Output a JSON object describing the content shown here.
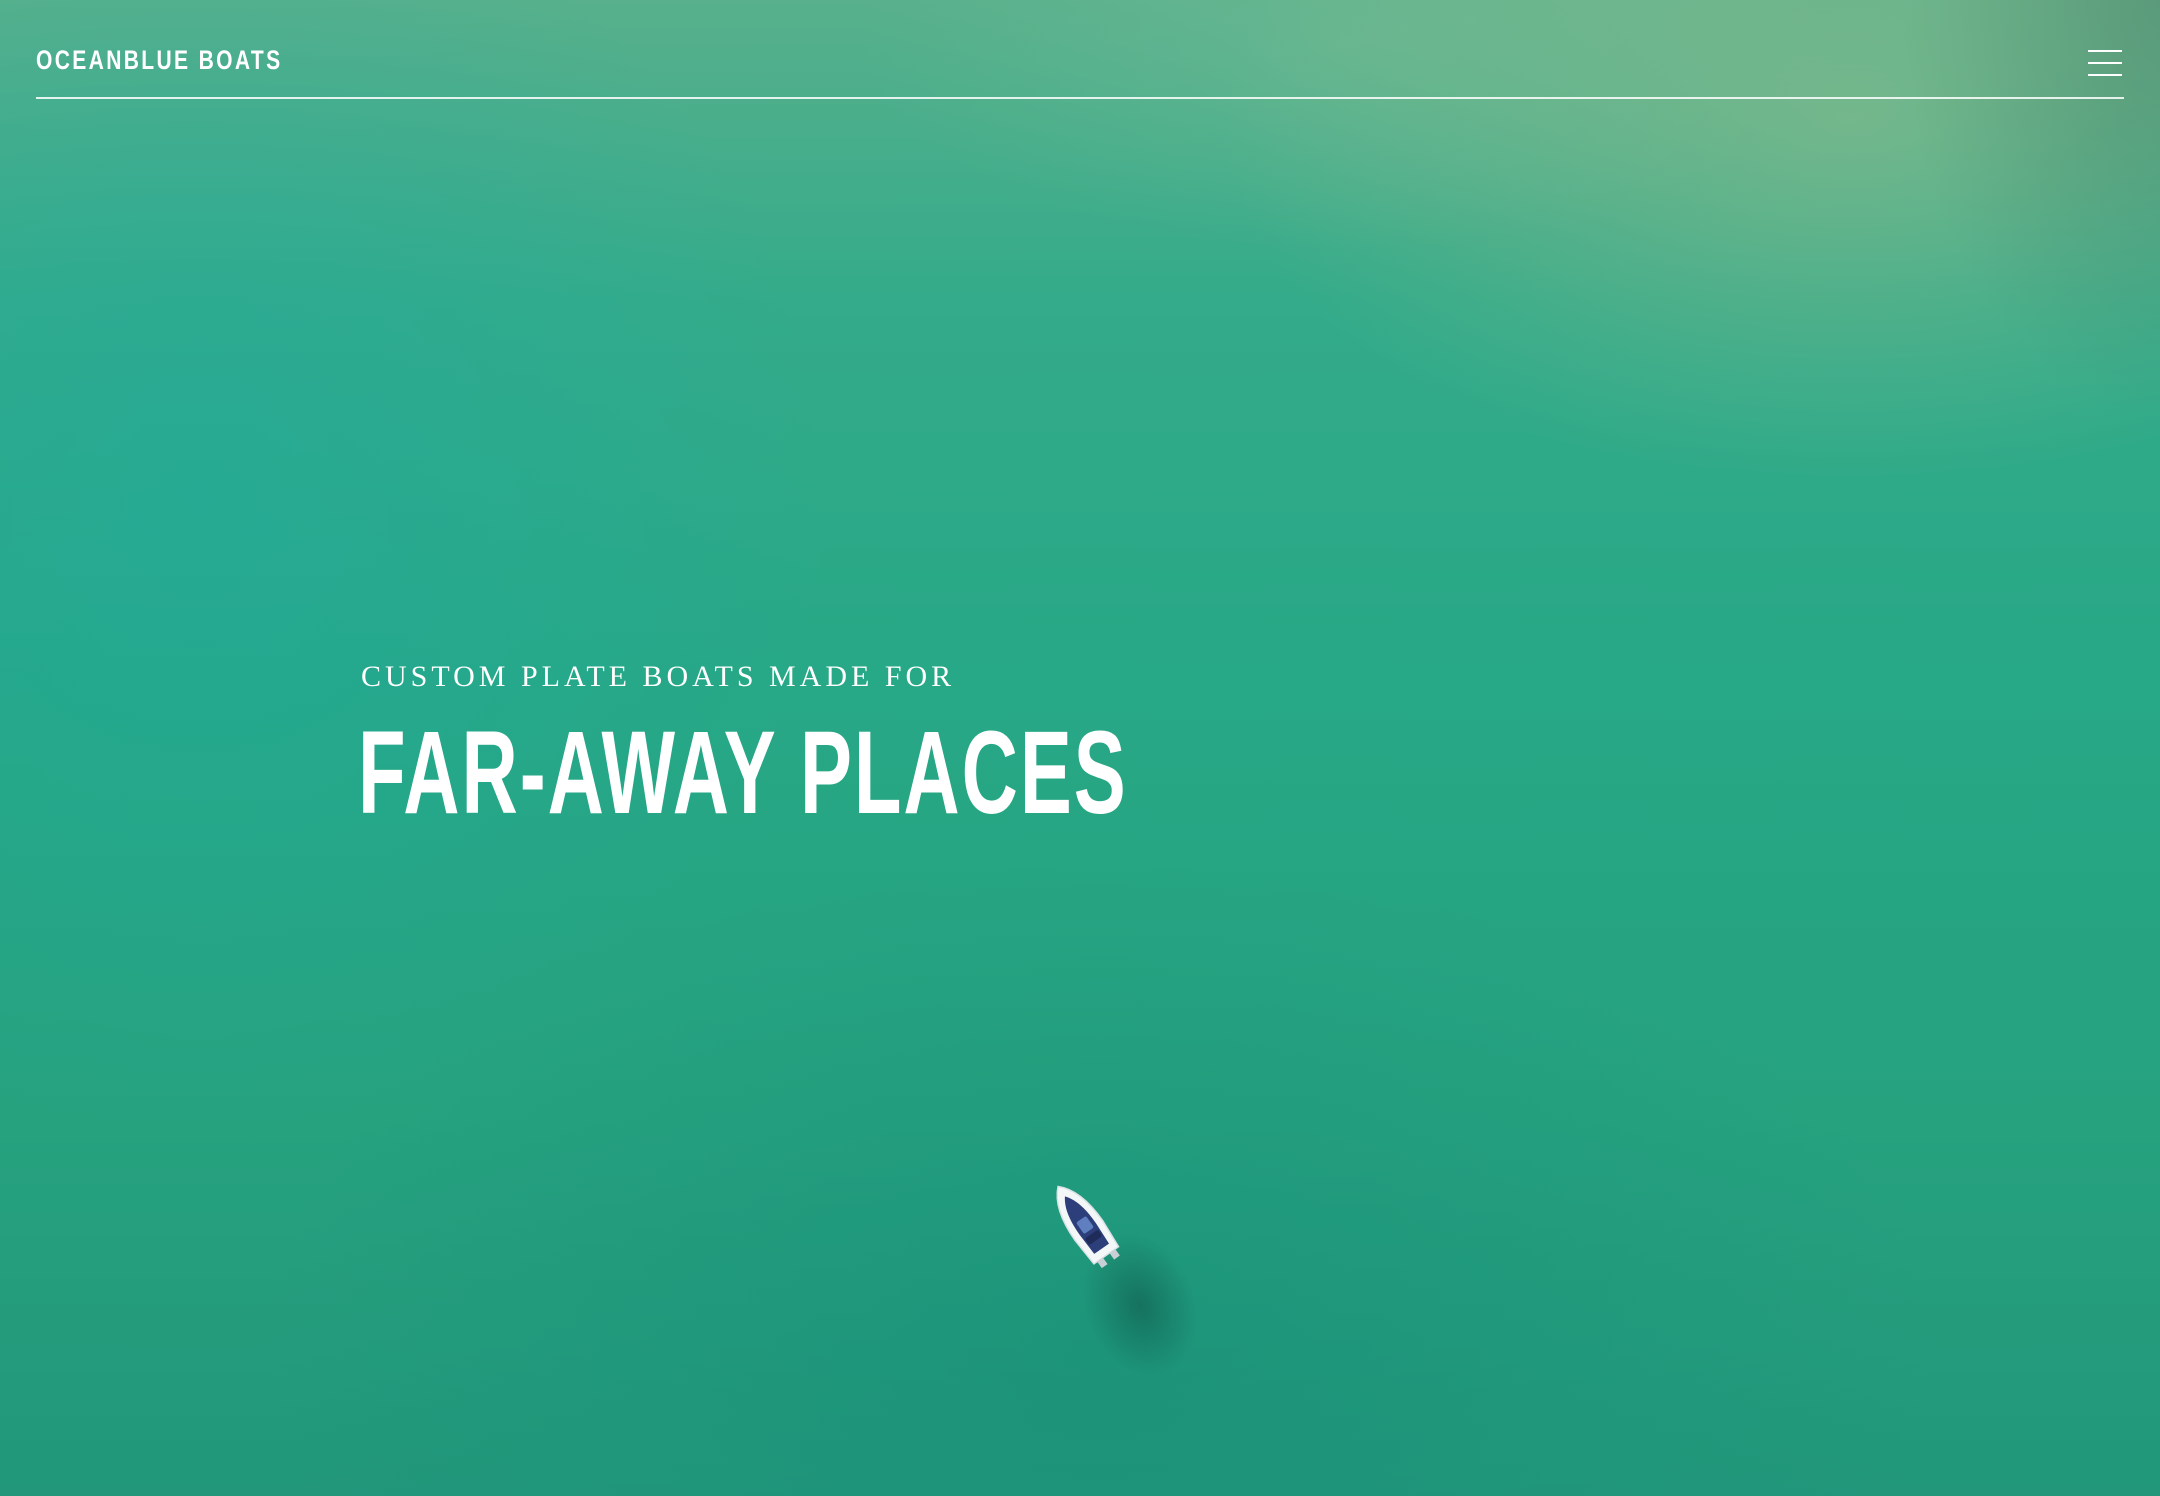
{
  "brand": {
    "logo_text": "OCEANBLUE BOATS"
  },
  "header": {
    "menu_icon": "hamburger-menu-icon"
  },
  "hero": {
    "tagline": "CUSTOM PLATE BOATS MADE FOR",
    "headline": "FAR-AWAY PLACES",
    "background": "aerial photo of turquoise sea with a small boat"
  },
  "colors": {
    "water": "#26a98a",
    "text": "#ffffff"
  }
}
